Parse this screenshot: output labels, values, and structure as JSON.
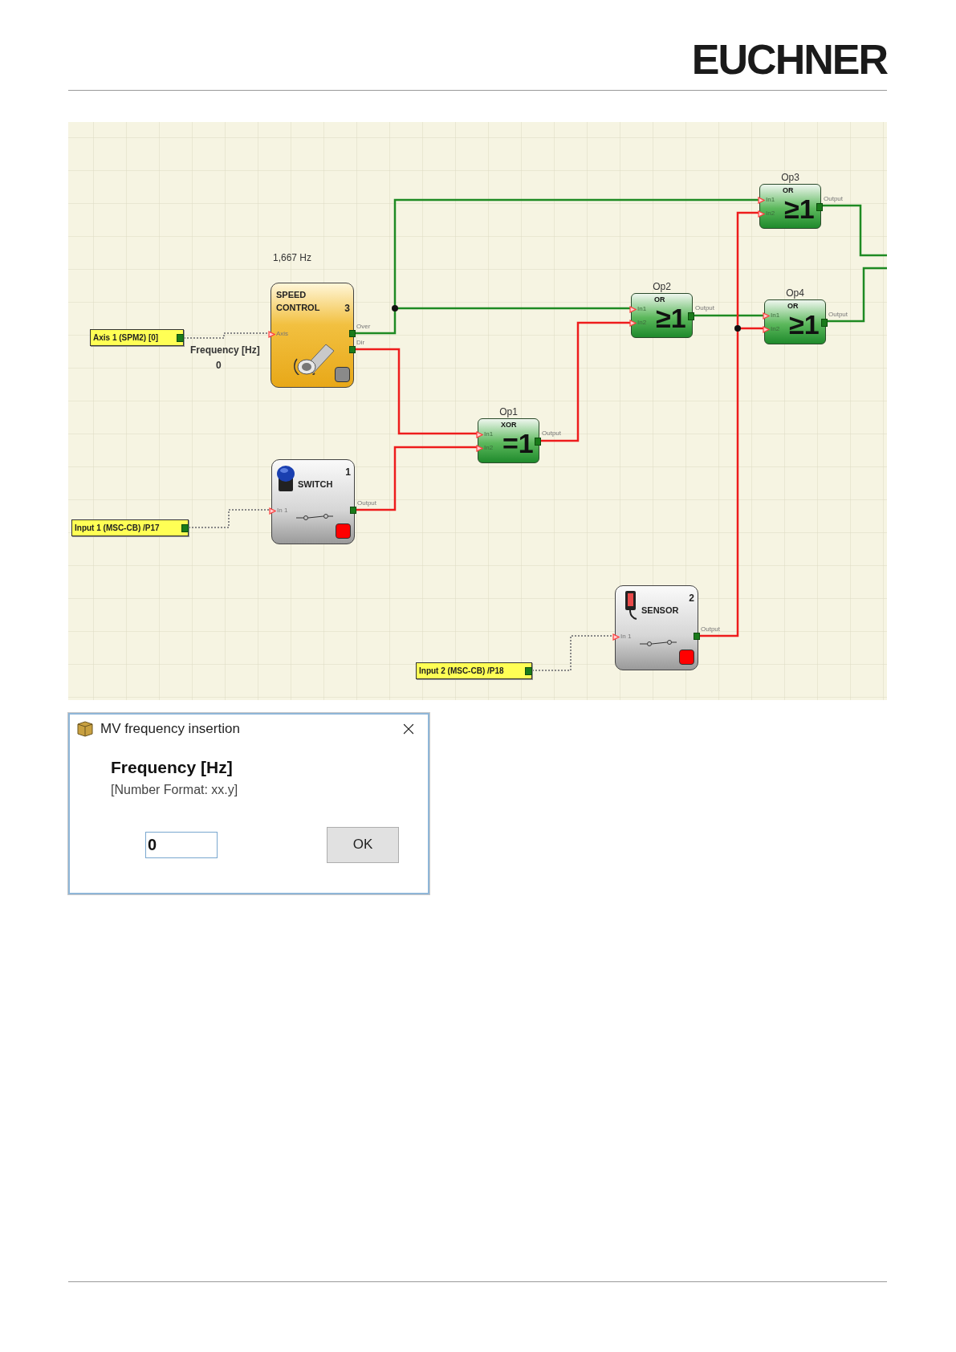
{
  "header": {
    "logo": "EUCHNER"
  },
  "diagram": {
    "frequency_reading": "1,667 Hz",
    "input_labels": [
      {
        "text": "Axis 1 (SPM2) [0]"
      },
      {
        "text": "Input 1 (MSC-CB) /P17"
      },
      {
        "text": "Input 2 (MSC-CB) /P18"
      }
    ],
    "parameter": {
      "label": "Frequency [Hz]",
      "value": "0"
    },
    "blocks": [
      {
        "kind": "speed_control",
        "title": "SPEED CONTROL",
        "number": "3",
        "inputs": [
          "Axis"
        ],
        "outputs": [
          "Over",
          "Dir"
        ],
        "color": "#8a8a8a"
      },
      {
        "kind": "switch",
        "title": "SWITCH",
        "number": "1",
        "inputs": [
          "In 1"
        ],
        "outputs": [
          "Output"
        ],
        "color": "#ff0000"
      },
      {
        "kind": "sensor",
        "title": "SENSOR",
        "number": "2",
        "inputs": [
          "In 1"
        ],
        "outputs": [
          "Output"
        ],
        "color": "#ff0000"
      }
    ],
    "gates": [
      {
        "name": "Op1",
        "type": "XOR",
        "symbol": "=1",
        "inputs": [
          "In1",
          "In2"
        ],
        "output": "Output"
      },
      {
        "name": "Op2",
        "type": "OR",
        "symbol": "≥1",
        "inputs": [
          "In1",
          "In2"
        ],
        "output": "Output"
      },
      {
        "name": "Op3",
        "type": "OR",
        "symbol": "≥1",
        "inputs": [
          "In1",
          "In2"
        ],
        "output": "Output"
      },
      {
        "name": "Op4",
        "type": "OR",
        "symbol": "≥1",
        "inputs": [
          "In1",
          "In2"
        ],
        "output": "Output"
      }
    ]
  },
  "dialog": {
    "title": "MV frequency insertion",
    "heading": "Frequency [Hz]",
    "hint": "[Number Format: xx.y]",
    "value": "0",
    "button": "OK"
  }
}
